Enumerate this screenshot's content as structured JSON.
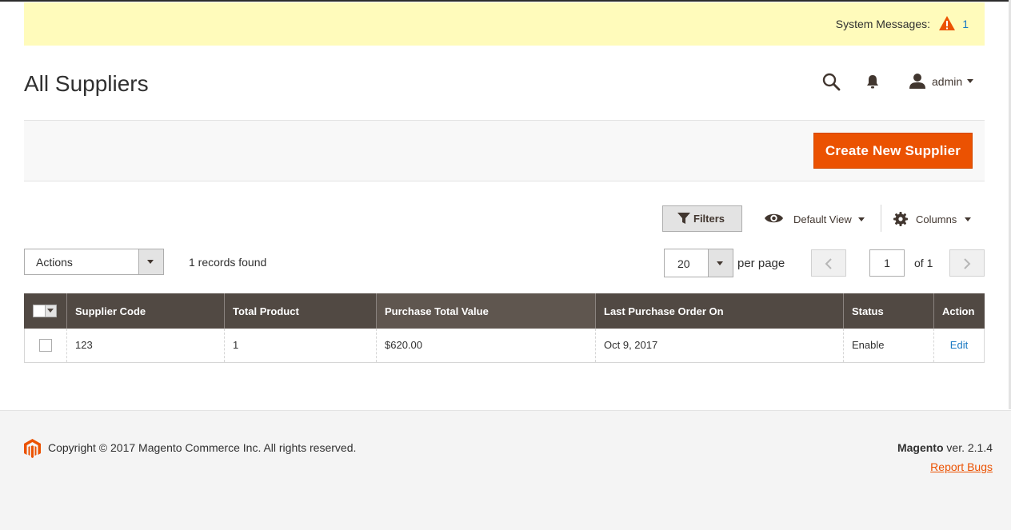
{
  "system_messages": {
    "label": "System Messages:",
    "count": "1"
  },
  "header": {
    "title": "All Suppliers",
    "user": "admin"
  },
  "actions_bar": {
    "create_button": "Create New Supplier"
  },
  "toolbar": {
    "filters_label": "Filters",
    "view_label": "Default View",
    "columns_label": "Columns",
    "mass_action_select": "Actions",
    "records_found": "1 records found",
    "per_page_value": "20",
    "per_page_label": "per page",
    "current_page": "1",
    "total_pages_label": "of 1"
  },
  "grid": {
    "columns": [
      "Supplier Code",
      "Total Product",
      "Purchase Total Value",
      "Last Purchase Order On",
      "Status",
      "Action"
    ],
    "rows": [
      {
        "supplier_code": "123",
        "total_product": "1",
        "purchase_total_value": "$620.00",
        "last_purchase_order_on": "Oct 9, 2017",
        "status": "Enable",
        "action": "Edit"
      }
    ]
  },
  "footer": {
    "copyright": "Copyright © 2017 Magento Commerce Inc. All rights reserved.",
    "brand": "Magento",
    "version": "ver. 2.1.4",
    "report_bugs": "Report Bugs"
  },
  "colors": {
    "accent": "#eb5202",
    "grid_header": "#514943",
    "link": "#1979c3",
    "notice_bg": "#fffbbb"
  }
}
